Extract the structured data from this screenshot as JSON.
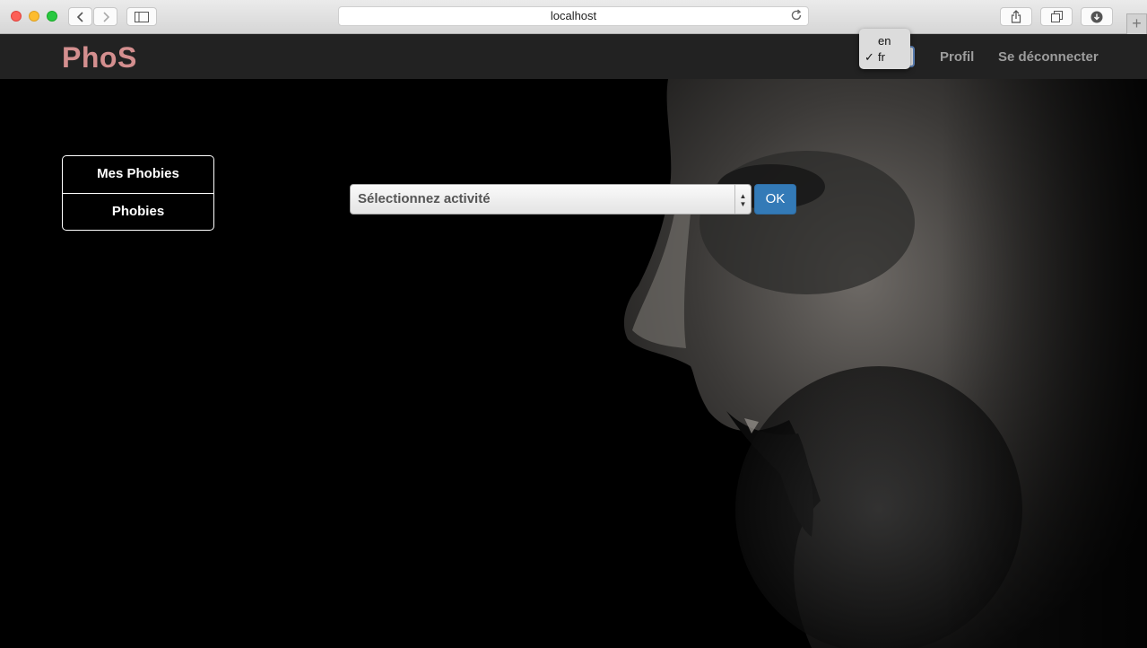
{
  "browser": {
    "url": "localhost"
  },
  "navbar": {
    "brand": "PhoS",
    "language_options": [
      "en",
      "fr"
    ],
    "language_selected": "fr",
    "links": {
      "profile": "Profil",
      "logout": "Se déconnecter"
    }
  },
  "side_menu": {
    "items": [
      "Mes Phobies",
      "Phobies"
    ]
  },
  "activity": {
    "placeholder": "Sélectionnez activité",
    "ok_label": "OK"
  },
  "colors": {
    "brand": "#d48f8f",
    "primary_button": "#337ab7",
    "navbar_bg": "#222222"
  }
}
